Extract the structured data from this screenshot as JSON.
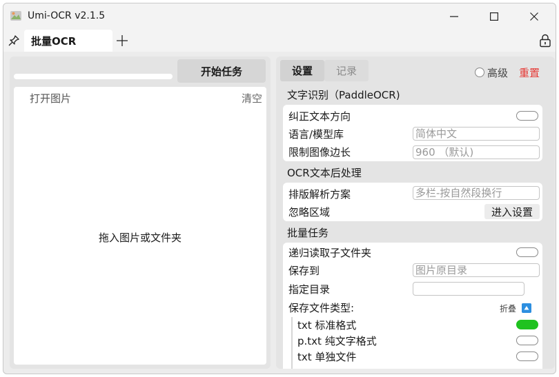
{
  "window": {
    "title": "Umi-OCR v2.1.5"
  },
  "tabs": [
    {
      "label": "批量OCR"
    }
  ],
  "left": {
    "start_label": "开始任务",
    "progress": 0,
    "open_label": "打开图片",
    "clear_label": "清空",
    "drop_hint": "拖入图片或文件夹"
  },
  "right": {
    "tab_settings": "设置",
    "tab_records": "记录",
    "advanced_label": "高级",
    "reset_label": "重置",
    "sections": {
      "ocr": {
        "title": "文字识别（PaddleOCR)",
        "rows": {
          "orient": {
            "label": "纠正文本方向",
            "on": false
          },
          "lang": {
            "label": "语言/模型库",
            "value": "简体中文"
          },
          "limit": {
            "label": "限制图像边长",
            "value": "960 （默认)"
          }
        }
      },
      "post": {
        "title": "OCR文本后处理",
        "rows": {
          "layout": {
            "label": "排版解析方案",
            "value": "多栏-按自然段换行"
          },
          "ignore": {
            "label": "忽略区域",
            "button": "进入设置"
          }
        }
      },
      "batch": {
        "title": "批量任务",
        "rows": {
          "recurse": {
            "label": "递归读取子文件夹",
            "on": false
          },
          "saveto": {
            "label": "保存到",
            "value": "图片原目录"
          },
          "dir": {
            "label": "指定目录",
            "value": ""
          },
          "types": {
            "label": "保存文件类型:",
            "fold_label": "折叠"
          },
          "txt": {
            "label": "txt 标准格式",
            "on": true
          },
          "ptxt": {
            "label": "p.txt 纯文字格式",
            "on": false
          },
          "txt_single": {
            "label": "txt 单独文件",
            "on": false
          }
        }
      }
    }
  },
  "colors": {
    "toggle_on": "#1fc21f",
    "reset": "#e53935",
    "fold_icon": "#2d8fe0"
  }
}
